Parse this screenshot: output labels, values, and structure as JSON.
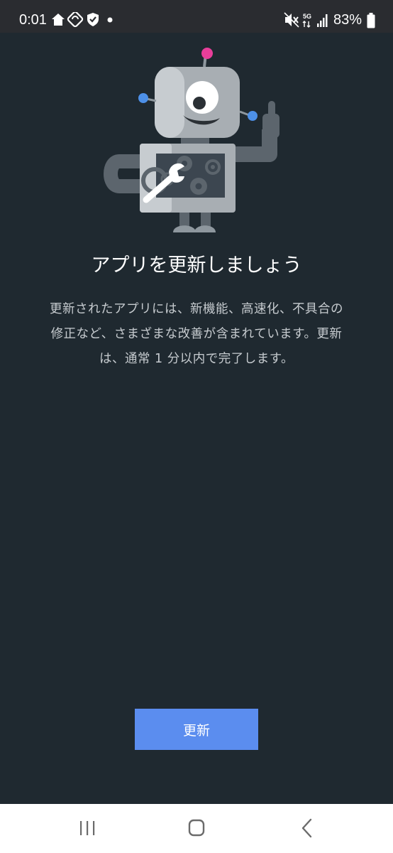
{
  "status_bar": {
    "time": "0:01",
    "network": "5G",
    "battery": "83%",
    "left_icons": [
      "home-icon",
      "sync-icon",
      "shield-check-icon",
      "dot-icon"
    ],
    "right_icons": [
      "mute-icon",
      "network-5g-icon",
      "signal-icon",
      "battery-icon"
    ]
  },
  "content": {
    "title": "アプリを更新しましょう",
    "description": "更新されたアプリには、新機能、高速化、不具合の修正など、さまざまな改善が含まれています。更新は、通常 1 分以内で完了します。"
  },
  "button": {
    "update_label": "更新"
  },
  "nav_bar": {
    "icons": [
      "recents-icon",
      "home-icon",
      "back-icon"
    ]
  },
  "colors": {
    "background": "#1f2930",
    "status_bar": "#2a2c30",
    "button": "#5b8def",
    "nav_bar": "#ffffff",
    "robot_antenna": "#e83e9a",
    "robot_ears": "#4d90e8"
  }
}
